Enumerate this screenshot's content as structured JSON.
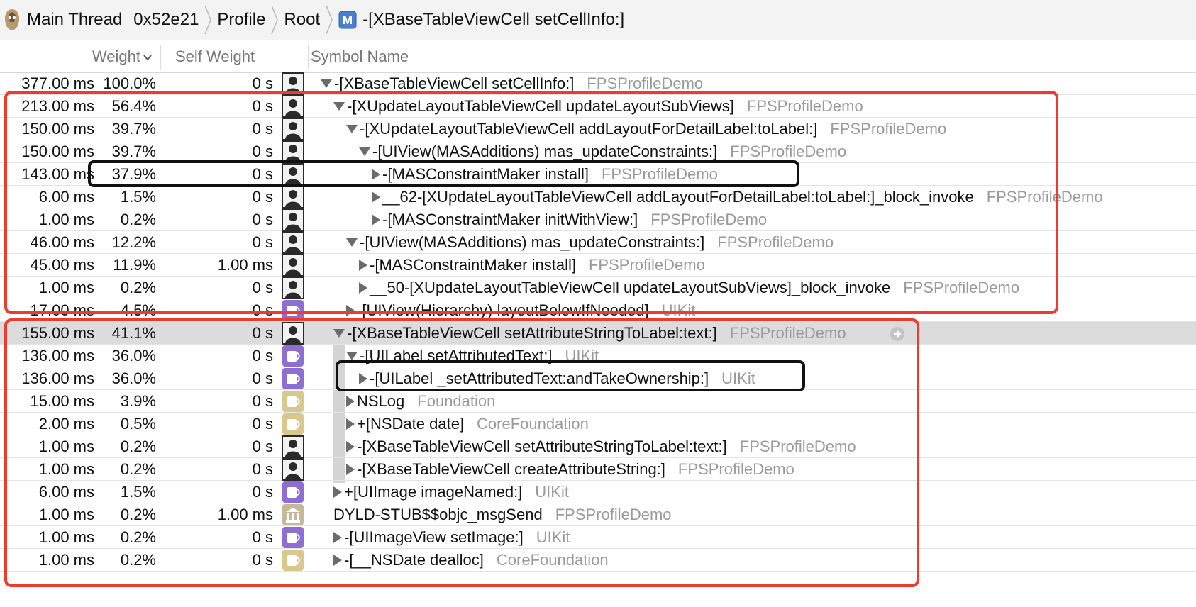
{
  "breadcrumb": {
    "thread_label": "Main Thread",
    "thread_id": "0x52e21",
    "profile": "Profile",
    "root": "Root",
    "method_badge": "M",
    "symbol": "-[XBaseTableViewCell setCellInfo:]"
  },
  "columns": {
    "weight": "Weight",
    "self_weight": "Self Weight",
    "symbol_name": "Symbol Name"
  },
  "rows": [
    {
      "ms": "377.00 ms",
      "pct": "100.0%",
      "self": "0 s",
      "icon": "person-icon",
      "disclosure": "down",
      "indent": 0,
      "symbol": "-[XBaseTableViewCell setCellInfo:]",
      "library": "FPSProfileDemo"
    },
    {
      "ms": "213.00 ms",
      "pct": "56.4%",
      "self": "0 s",
      "icon": "person-icon",
      "disclosure": "down",
      "indent": 1,
      "symbol": "-[XUpdateLayoutTableViewCell updateLayoutSubViews]",
      "library": "FPSProfileDemo"
    },
    {
      "ms": "150.00 ms",
      "pct": "39.7%",
      "self": "0 s",
      "icon": "person-icon",
      "disclosure": "down",
      "indent": 2,
      "symbol": "-[XUpdateLayoutTableViewCell addLayoutForDetailLabel:toLabel:]",
      "library": "FPSProfileDemo"
    },
    {
      "ms": "150.00 ms",
      "pct": "39.7%",
      "self": "0 s",
      "icon": "person-icon",
      "disclosure": "down",
      "indent": 3,
      "symbol": "-[UIView(MASAdditions) mas_updateConstraints:]",
      "library": "FPSProfileDemo"
    },
    {
      "ms": "143.00 ms",
      "pct": "37.9%",
      "self": "0 s",
      "icon": "person-icon",
      "disclosure": "right",
      "indent": 4,
      "symbol": "-[MASConstraintMaker install]",
      "library": "FPSProfileDemo"
    },
    {
      "ms": "6.00 ms",
      "pct": "1.5%",
      "self": "0 s",
      "icon": "person-icon",
      "disclosure": "right",
      "indent": 4,
      "symbol": "__62-[XUpdateLayoutTableViewCell addLayoutForDetailLabel:toLabel:]_block_invoke",
      "library": "FPSProfileDemo"
    },
    {
      "ms": "1.00 ms",
      "pct": "0.2%",
      "self": "0 s",
      "icon": "person-icon",
      "disclosure": "right",
      "indent": 4,
      "symbol": "-[MASConstraintMaker initWithView:]",
      "library": "FPSProfileDemo"
    },
    {
      "ms": "46.00 ms",
      "pct": "12.2%",
      "self": "0 s",
      "icon": "person-icon",
      "disclosure": "down",
      "indent": 2,
      "symbol": "-[UIView(MASAdditions) mas_updateConstraints:]",
      "library": "FPSProfileDemo"
    },
    {
      "ms": "45.00 ms",
      "pct": "11.9%",
      "self": "1.00 ms",
      "icon": "person-icon",
      "disclosure": "right",
      "indent": 3,
      "symbol": "-[MASConstraintMaker install]",
      "library": "FPSProfileDemo"
    },
    {
      "ms": "1.00 ms",
      "pct": "0.2%",
      "self": "0 s",
      "icon": "person-icon",
      "disclosure": "right",
      "indent": 3,
      "symbol": "__50-[XUpdateLayoutTableViewCell updateLayoutSubViews]_block_invoke",
      "library": "FPSProfileDemo"
    },
    {
      "ms": "17.00 ms",
      "pct": "4.5%",
      "self": "0 s",
      "icon": "cup-purple-icon",
      "disclosure": "right",
      "indent": 2,
      "symbol": "-[UIView(Hierarchy) layoutBelowIfNeeded]",
      "library": "UIKit"
    },
    {
      "ms": "155.00 ms",
      "pct": "41.1%",
      "self": "0 s",
      "icon": "person-icon",
      "disclosure": "down",
      "indent": 1,
      "symbol": "-[XBaseTableViewCell setAttributeStringToLabel:text:]",
      "library": "FPSProfileDemo",
      "selected": true
    },
    {
      "ms": "136.00 ms",
      "pct": "36.0%",
      "self": "0 s",
      "icon": "cup-purple-icon",
      "disclosure": "down",
      "indent": 2,
      "symbol": "-[UILabel setAttributedText:]",
      "library": "UIKit"
    },
    {
      "ms": "136.00 ms",
      "pct": "36.0%",
      "self": "0 s",
      "icon": "cup-purple-icon",
      "disclosure": "right",
      "indent": 3,
      "symbol": "-[UILabel _setAttributedText:andTakeOwnership:]",
      "library": "UIKit"
    },
    {
      "ms": "15.00 ms",
      "pct": "3.9%",
      "self": "0 s",
      "icon": "cup-tan-icon",
      "disclosure": "right",
      "indent": 2,
      "symbol": "NSLog",
      "library": "Foundation"
    },
    {
      "ms": "2.00 ms",
      "pct": "0.5%",
      "self": "0 s",
      "icon": "cup-tan-icon",
      "disclosure": "right",
      "indent": 2,
      "symbol": "+[NSDate date]",
      "library": "CoreFoundation"
    },
    {
      "ms": "1.00 ms",
      "pct": "0.2%",
      "self": "0 s",
      "icon": "person-icon",
      "disclosure": "right",
      "indent": 2,
      "symbol": "-[XBaseTableViewCell setAttributeStringToLabel:text:]",
      "library": "FPSProfileDemo"
    },
    {
      "ms": "1.00 ms",
      "pct": "0.2%",
      "self": "0 s",
      "icon": "person-icon",
      "disclosure": "right",
      "indent": 2,
      "symbol": "-[XBaseTableViewCell createAttributeString:]",
      "library": "FPSProfileDemo"
    },
    {
      "ms": "6.00 ms",
      "pct": "1.5%",
      "self": "0 s",
      "icon": "cup-purple-icon",
      "disclosure": "right",
      "indent": 1,
      "symbol": "+[UIImage imageNamed:]",
      "library": "UIKit"
    },
    {
      "ms": "1.00 ms",
      "pct": "0.2%",
      "self": "1.00 ms",
      "icon": "library-icon",
      "disclosure": "none",
      "indent": 1,
      "symbol": "DYLD-STUB$$objc_msgSend",
      "library": "FPSProfileDemo"
    },
    {
      "ms": "1.00 ms",
      "pct": "0.2%",
      "self": "0 s",
      "icon": "cup-purple-icon",
      "disclosure": "right",
      "indent": 1,
      "symbol": "-[UIImageView setImage:]",
      "library": "UIKit"
    },
    {
      "ms": "1.00 ms",
      "pct": "0.2%",
      "self": "0 s",
      "icon": "cup-tan-icon",
      "disclosure": "right",
      "indent": 1,
      "symbol": "-[__NSDate dealloc]",
      "library": "CoreFoundation"
    }
  ],
  "colors": {
    "annotation_red": "#f03a2e",
    "annotation_black": "#111111",
    "library_text": "#9a9a9a",
    "selected_row": "#dcdcdc"
  }
}
